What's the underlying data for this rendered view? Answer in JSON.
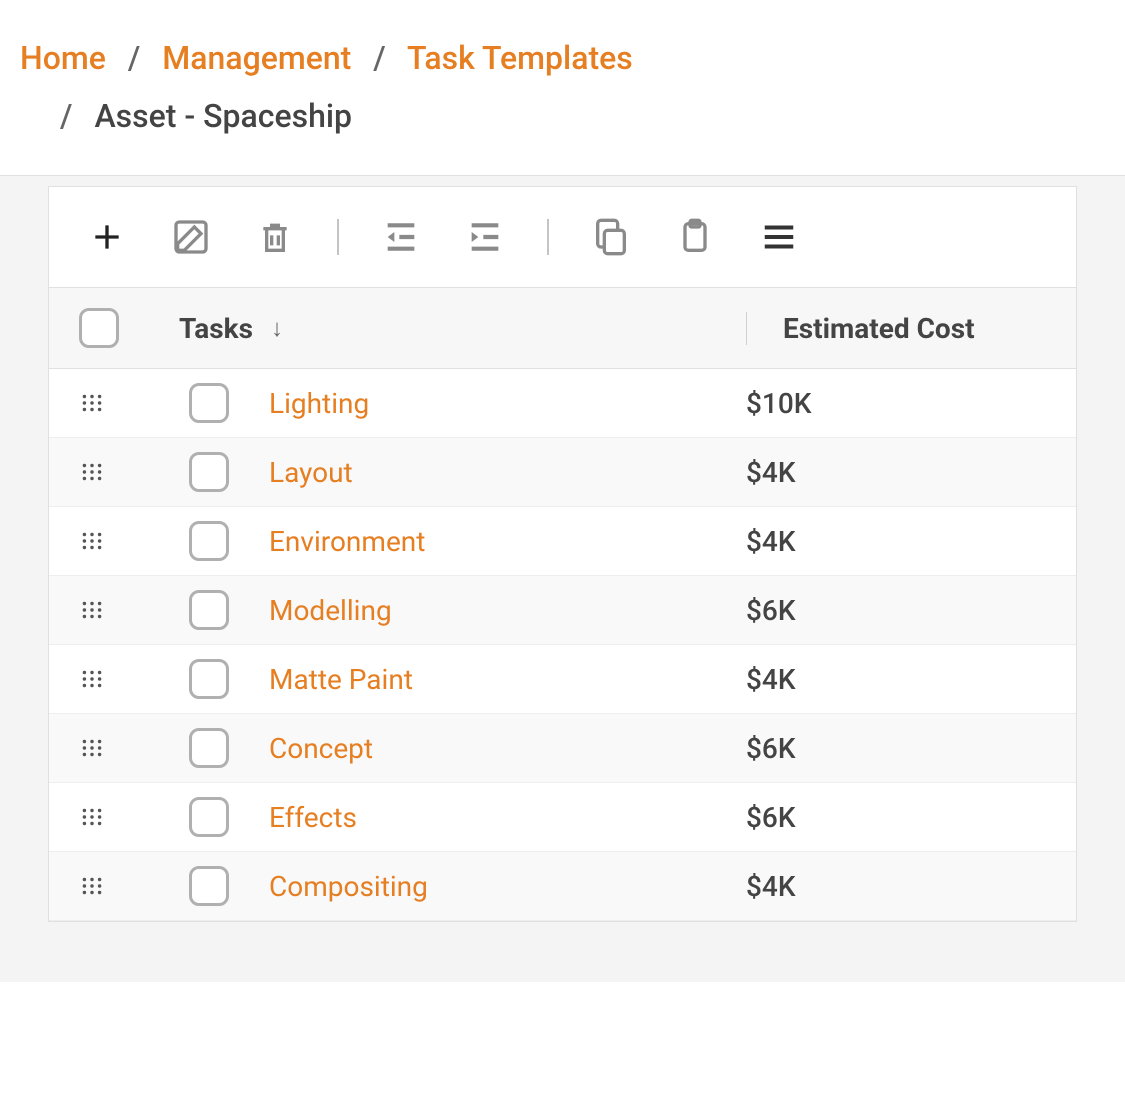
{
  "breadcrumb": {
    "items": [
      {
        "label": "Home",
        "link": true
      },
      {
        "label": "Management",
        "link": true
      },
      {
        "label": "Task Templates",
        "link": true
      },
      {
        "label": "Asset - Spaceship",
        "link": false
      }
    ],
    "separator": "/"
  },
  "table": {
    "columns": {
      "tasks": "Tasks",
      "cost": "Estimated Cost"
    },
    "sort_direction": "↓",
    "rows": [
      {
        "name": "Lighting",
        "cost": "$10K"
      },
      {
        "name": "Layout",
        "cost": "$4K"
      },
      {
        "name": "Environment",
        "cost": "$4K"
      },
      {
        "name": "Modelling",
        "cost": "$6K"
      },
      {
        "name": "Matte Paint",
        "cost": "$4K"
      },
      {
        "name": "Concept",
        "cost": "$6K"
      },
      {
        "name": "Effects",
        "cost": "$6K"
      },
      {
        "name": "Compositing",
        "cost": "$4K"
      }
    ]
  }
}
